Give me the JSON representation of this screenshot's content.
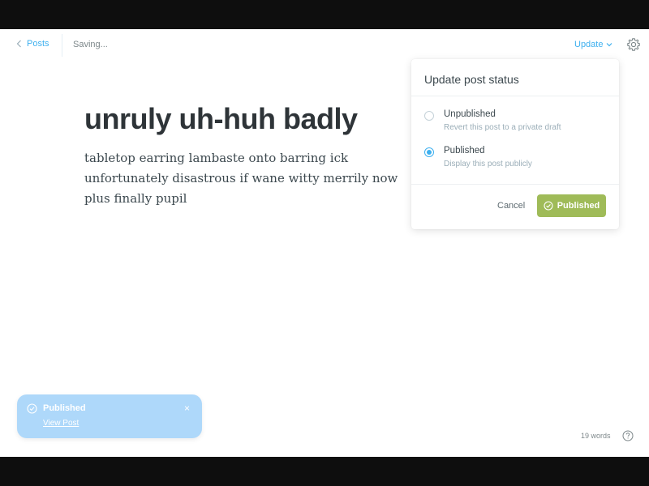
{
  "topbar": {
    "back_label": "Posts",
    "status": "Saving...",
    "update_label": "Update"
  },
  "editor": {
    "title": "unruly uh-huh badly",
    "body": "tabletop earring lambaste onto barring ick unfortunately disastrous if wane witty merrily now plus finally pupil"
  },
  "popover": {
    "title": "Update post status",
    "options": [
      {
        "label": "Unpublished",
        "description": "Revert this post to a private draft",
        "selected": false
      },
      {
        "label": "Published",
        "description": "Display this post publicly",
        "selected": true
      }
    ],
    "cancel_label": "Cancel",
    "confirm_label": "Published"
  },
  "toast": {
    "title": "Published",
    "link": "View Post",
    "close": "×"
  },
  "footer": {
    "word_count": "19 words"
  },
  "colors": {
    "accent": "#3eb0ef",
    "publish_green": "#9fbb58",
    "toast_bg": "#aed8fa"
  },
  "icons": [
    "chevron-left-icon",
    "chevron-down-icon",
    "gear-icon",
    "check-circle-icon",
    "close-icon",
    "help-icon"
  ]
}
